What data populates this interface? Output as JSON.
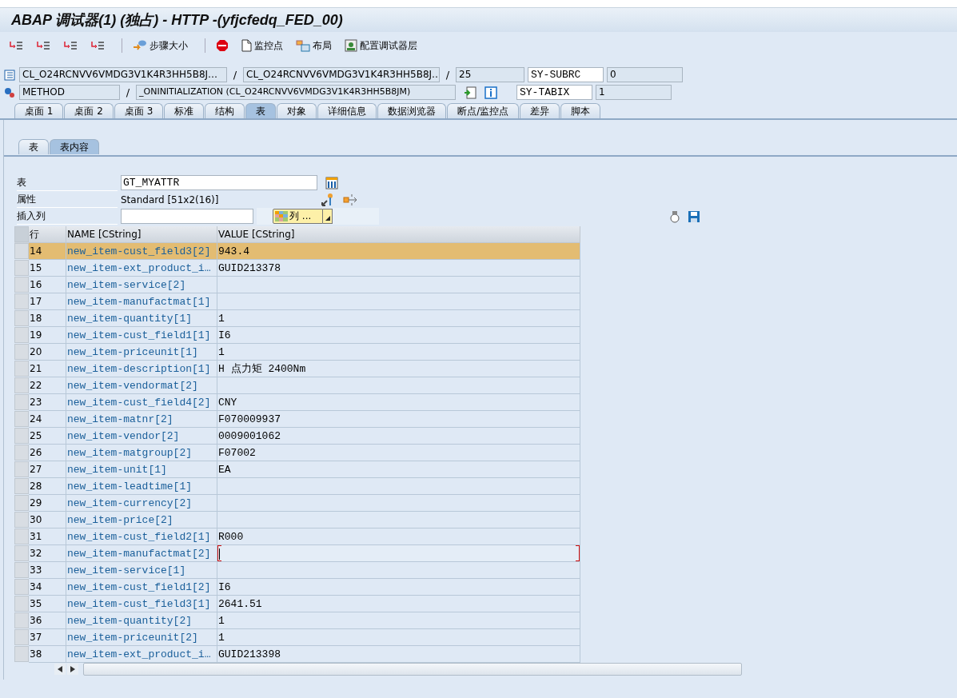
{
  "window": {
    "title": "ABAP 调试器(1) (独占) - HTTP -(yfjcfedq_FED_00)"
  },
  "toolbar": [
    {
      "kind": "step-into"
    },
    {
      "kind": "step-over"
    },
    {
      "kind": "return"
    },
    {
      "kind": "continue",
      "separator_after": true
    },
    {
      "kind": "step-size",
      "label": "步骤大小",
      "separator_after": true
    },
    {
      "kind": "stop"
    },
    {
      "kind": "watchpoint",
      "label": "监控点"
    },
    {
      "kind": "layout",
      "label": "布局"
    },
    {
      "kind": "config",
      "label": "配置调试器层"
    }
  ],
  "context": {
    "slashes": [
      "/",
      "/",
      "/"
    ],
    "program": "CL_O24RCNVV6VMDG3V1K4R3HH5B8J…",
    "include": "CL_O24RCNVV6VMDG3V1K4R3HH5B8J…",
    "line": "25",
    "event_type": "METHOD",
    "event": "_ONINITIALIZATION (CL_O24RCNVV6VMDG3V1K4R3HH5B8JM)",
    "sysvars": [
      {
        "name": "SY-SUBRC",
        "value": "0"
      },
      {
        "name": "SY-TABIX",
        "value": "1"
      }
    ]
  },
  "tabs": [
    {
      "label": "桌面 1",
      "selected": false
    },
    {
      "label": "桌面 2",
      "selected": false
    },
    {
      "label": "桌面 3",
      "selected": false
    },
    {
      "label": "标准",
      "selected": false
    },
    {
      "label": "结构",
      "selected": false
    },
    {
      "label": "表",
      "selected": true
    },
    {
      "label": "对象",
      "selected": false
    },
    {
      "label": "详细信息",
      "selected": false
    },
    {
      "label": "数据浏览器",
      "selected": false
    },
    {
      "label": "断点/监控点",
      "selected": false
    },
    {
      "label": "差异",
      "selected": false
    },
    {
      "label": "脚本",
      "selected": false
    }
  ],
  "subtabs": [
    {
      "label": "表",
      "selected": false
    },
    {
      "label": "表内容",
      "selected": true
    }
  ],
  "form": {
    "table_label": "表",
    "table_value": "GT_MYATTR",
    "attr_label": "属性",
    "attr_value": "Standard [51x2(16)]",
    "insert_label": "插入列",
    "columns_button": "列 ..."
  },
  "table": {
    "columns": [
      "行",
      "NAME [CString]",
      "VALUE [CString]"
    ],
    "rows": [
      {
        "row": "14",
        "name": "new_item-cust_field3[2]",
        "value": "943.4",
        "selected": true,
        "focused": false
      },
      {
        "row": "15",
        "name": "new_item-ext_product_i…",
        "value": "GUID213378",
        "selected": false,
        "focused": false
      },
      {
        "row": "16",
        "name": "new_item-service[2]",
        "value": "",
        "selected": false,
        "focused": false
      },
      {
        "row": "17",
        "name": "new_item-manufactmat[1]",
        "value": "",
        "selected": false,
        "focused": false
      },
      {
        "row": "18",
        "name": "new_item-quantity[1]",
        "value": "1",
        "selected": false,
        "focused": false
      },
      {
        "row": "19",
        "name": "new_item-cust_field1[1]",
        "value": "I6",
        "selected": false,
        "focused": false
      },
      {
        "row": "20",
        "name": "new_item-priceunit[1]",
        "value": "1",
        "selected": false,
        "focused": false
      },
      {
        "row": "21",
        "name": "new_item-description[1]",
        "value": "H 点力矩 2400Nm",
        "selected": false,
        "focused": false
      },
      {
        "row": "22",
        "name": "new_item-vendormat[2]",
        "value": "",
        "selected": false,
        "focused": false
      },
      {
        "row": "23",
        "name": "new_item-cust_field4[2]",
        "value": "CNY",
        "selected": false,
        "focused": false
      },
      {
        "row": "24",
        "name": "new_item-matnr[2]",
        "value": "F070009937",
        "selected": false,
        "focused": false
      },
      {
        "row": "25",
        "name": "new_item-vendor[2]",
        "value": "0009001062",
        "selected": false,
        "focused": false
      },
      {
        "row": "26",
        "name": "new_item-matgroup[2]",
        "value": "F07002",
        "selected": false,
        "focused": false
      },
      {
        "row": "27",
        "name": "new_item-unit[1]",
        "value": "EA",
        "selected": false,
        "focused": false
      },
      {
        "row": "28",
        "name": "new_item-leadtime[1]",
        "value": "",
        "selected": false,
        "focused": false
      },
      {
        "row": "29",
        "name": "new_item-currency[2]",
        "value": "",
        "selected": false,
        "focused": false
      },
      {
        "row": "30",
        "name": "new_item-price[2]",
        "value": "",
        "selected": false,
        "focused": false
      },
      {
        "row": "31",
        "name": "new_item-cust_field2[1]",
        "value": "R000",
        "selected": false,
        "focused": false
      },
      {
        "row": "32",
        "name": "new_item-manufactmat[2]",
        "value": "",
        "selected": false,
        "focused": true
      },
      {
        "row": "33",
        "name": "new_item-service[1]",
        "value": "",
        "selected": false,
        "focused": false
      },
      {
        "row": "34",
        "name": "new_item-cust_field1[2]",
        "value": "I6",
        "selected": false,
        "focused": false
      },
      {
        "row": "35",
        "name": "new_item-cust_field3[1]",
        "value": "2641.51",
        "selected": false,
        "focused": false
      },
      {
        "row": "36",
        "name": "new_item-quantity[2]",
        "value": "1",
        "selected": false,
        "focused": false
      },
      {
        "row": "37",
        "name": "new_item-priceunit[2]",
        "value": "1",
        "selected": false,
        "focused": false
      },
      {
        "row": "38",
        "name": "new_item-ext_product_i…",
        "value": "GUID213398",
        "selected": false,
        "focused": false
      }
    ]
  }
}
